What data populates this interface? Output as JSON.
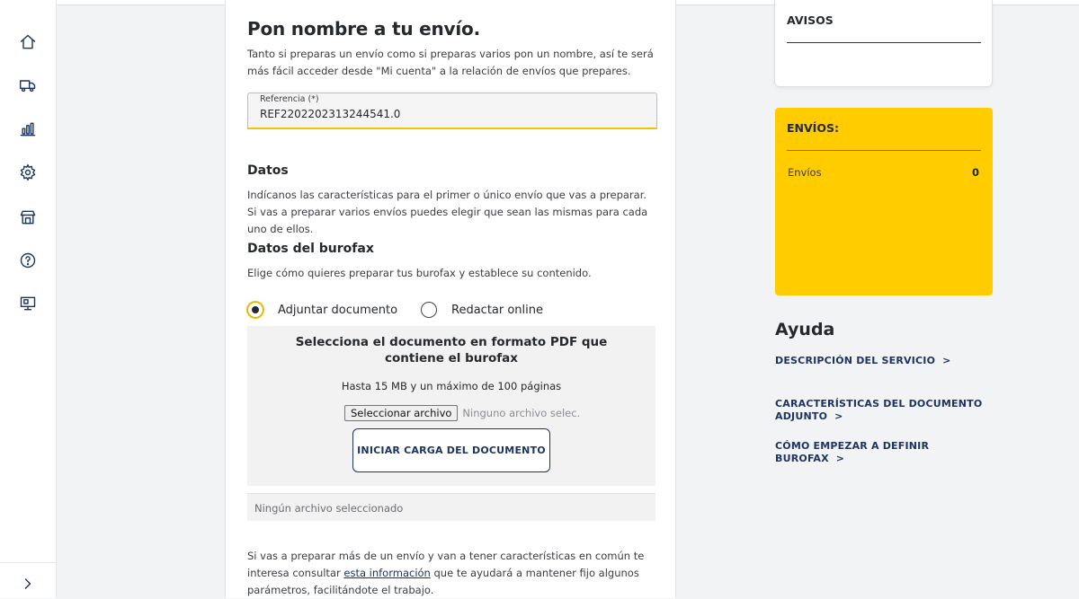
{
  "sidebar": {
    "items": [
      {
        "icon": "home-icon"
      },
      {
        "icon": "truck-icon"
      },
      {
        "icon": "bar-chart-icon"
      },
      {
        "icon": "gear-icon"
      },
      {
        "icon": "store-icon"
      },
      {
        "icon": "help-circle-icon"
      },
      {
        "icon": "monitor-icon"
      }
    ],
    "expand_icon": "chevron-right-icon"
  },
  "main": {
    "title": "Pon nombre a tu envío.",
    "intro": "Tanto si preparas un envío como si preparas varios pon un nombre, así te será más fácil acceder desde \"Mi cuenta\" a la relación de envíos que prepares.",
    "reference": {
      "label": "Referencia (*)",
      "value": "REF2202202313244541.0"
    },
    "datos": {
      "title": "Datos",
      "text": "Indícanos las características para el primer o único envío que vas a preparar. Si vas a preparar varios envíos puedes elegir que sean las mismas para cada uno de ellos."
    },
    "burofax": {
      "title": "Datos del burofax",
      "text": "Elige cómo quieres preparar tus burofax y establece su contenido.",
      "options": [
        {
          "label": "Adjuntar documento",
          "selected": true
        },
        {
          "label": "Redactar online",
          "selected": false
        }
      ]
    },
    "upload": {
      "title": "Selecciona el documento en formato PDF que contiene el burofax",
      "hint": "Hasta 15 MB y un máximo de 100 páginas",
      "file_button": "Seleccionar archivo",
      "file_status": "Ninguno archivo selec.",
      "upload_button": "INICIAR CARGA DEL DOCUMENTO",
      "no_file_text": "Ningún archivo seleccionado"
    },
    "footer": {
      "text_before": "Si vas a preparar más de un envío y van a tener características en común te interesa consultar ",
      "link": "esta información",
      "text_after": " que te ayudará a mantener fijo algunos parámetros, facilitándote el trabajo."
    }
  },
  "right": {
    "avisos_title": "AVISOS",
    "envios": {
      "title": "ENVÍOS:",
      "label": "Envíos",
      "count": "0"
    },
    "ayuda": {
      "title": "Ayuda",
      "links": [
        "DESCRIPCIÓN DEL SERVICIO",
        "CARACTERÍSTICAS DEL DOCUMENTO ADJUNTO",
        "CÓMO EMPEZAR A DEFINIR BUROFAX"
      ],
      "chevron": ">"
    }
  },
  "colors": {
    "accent_yellow": "#ffcc00",
    "brand_navy": "#1d3461"
  }
}
